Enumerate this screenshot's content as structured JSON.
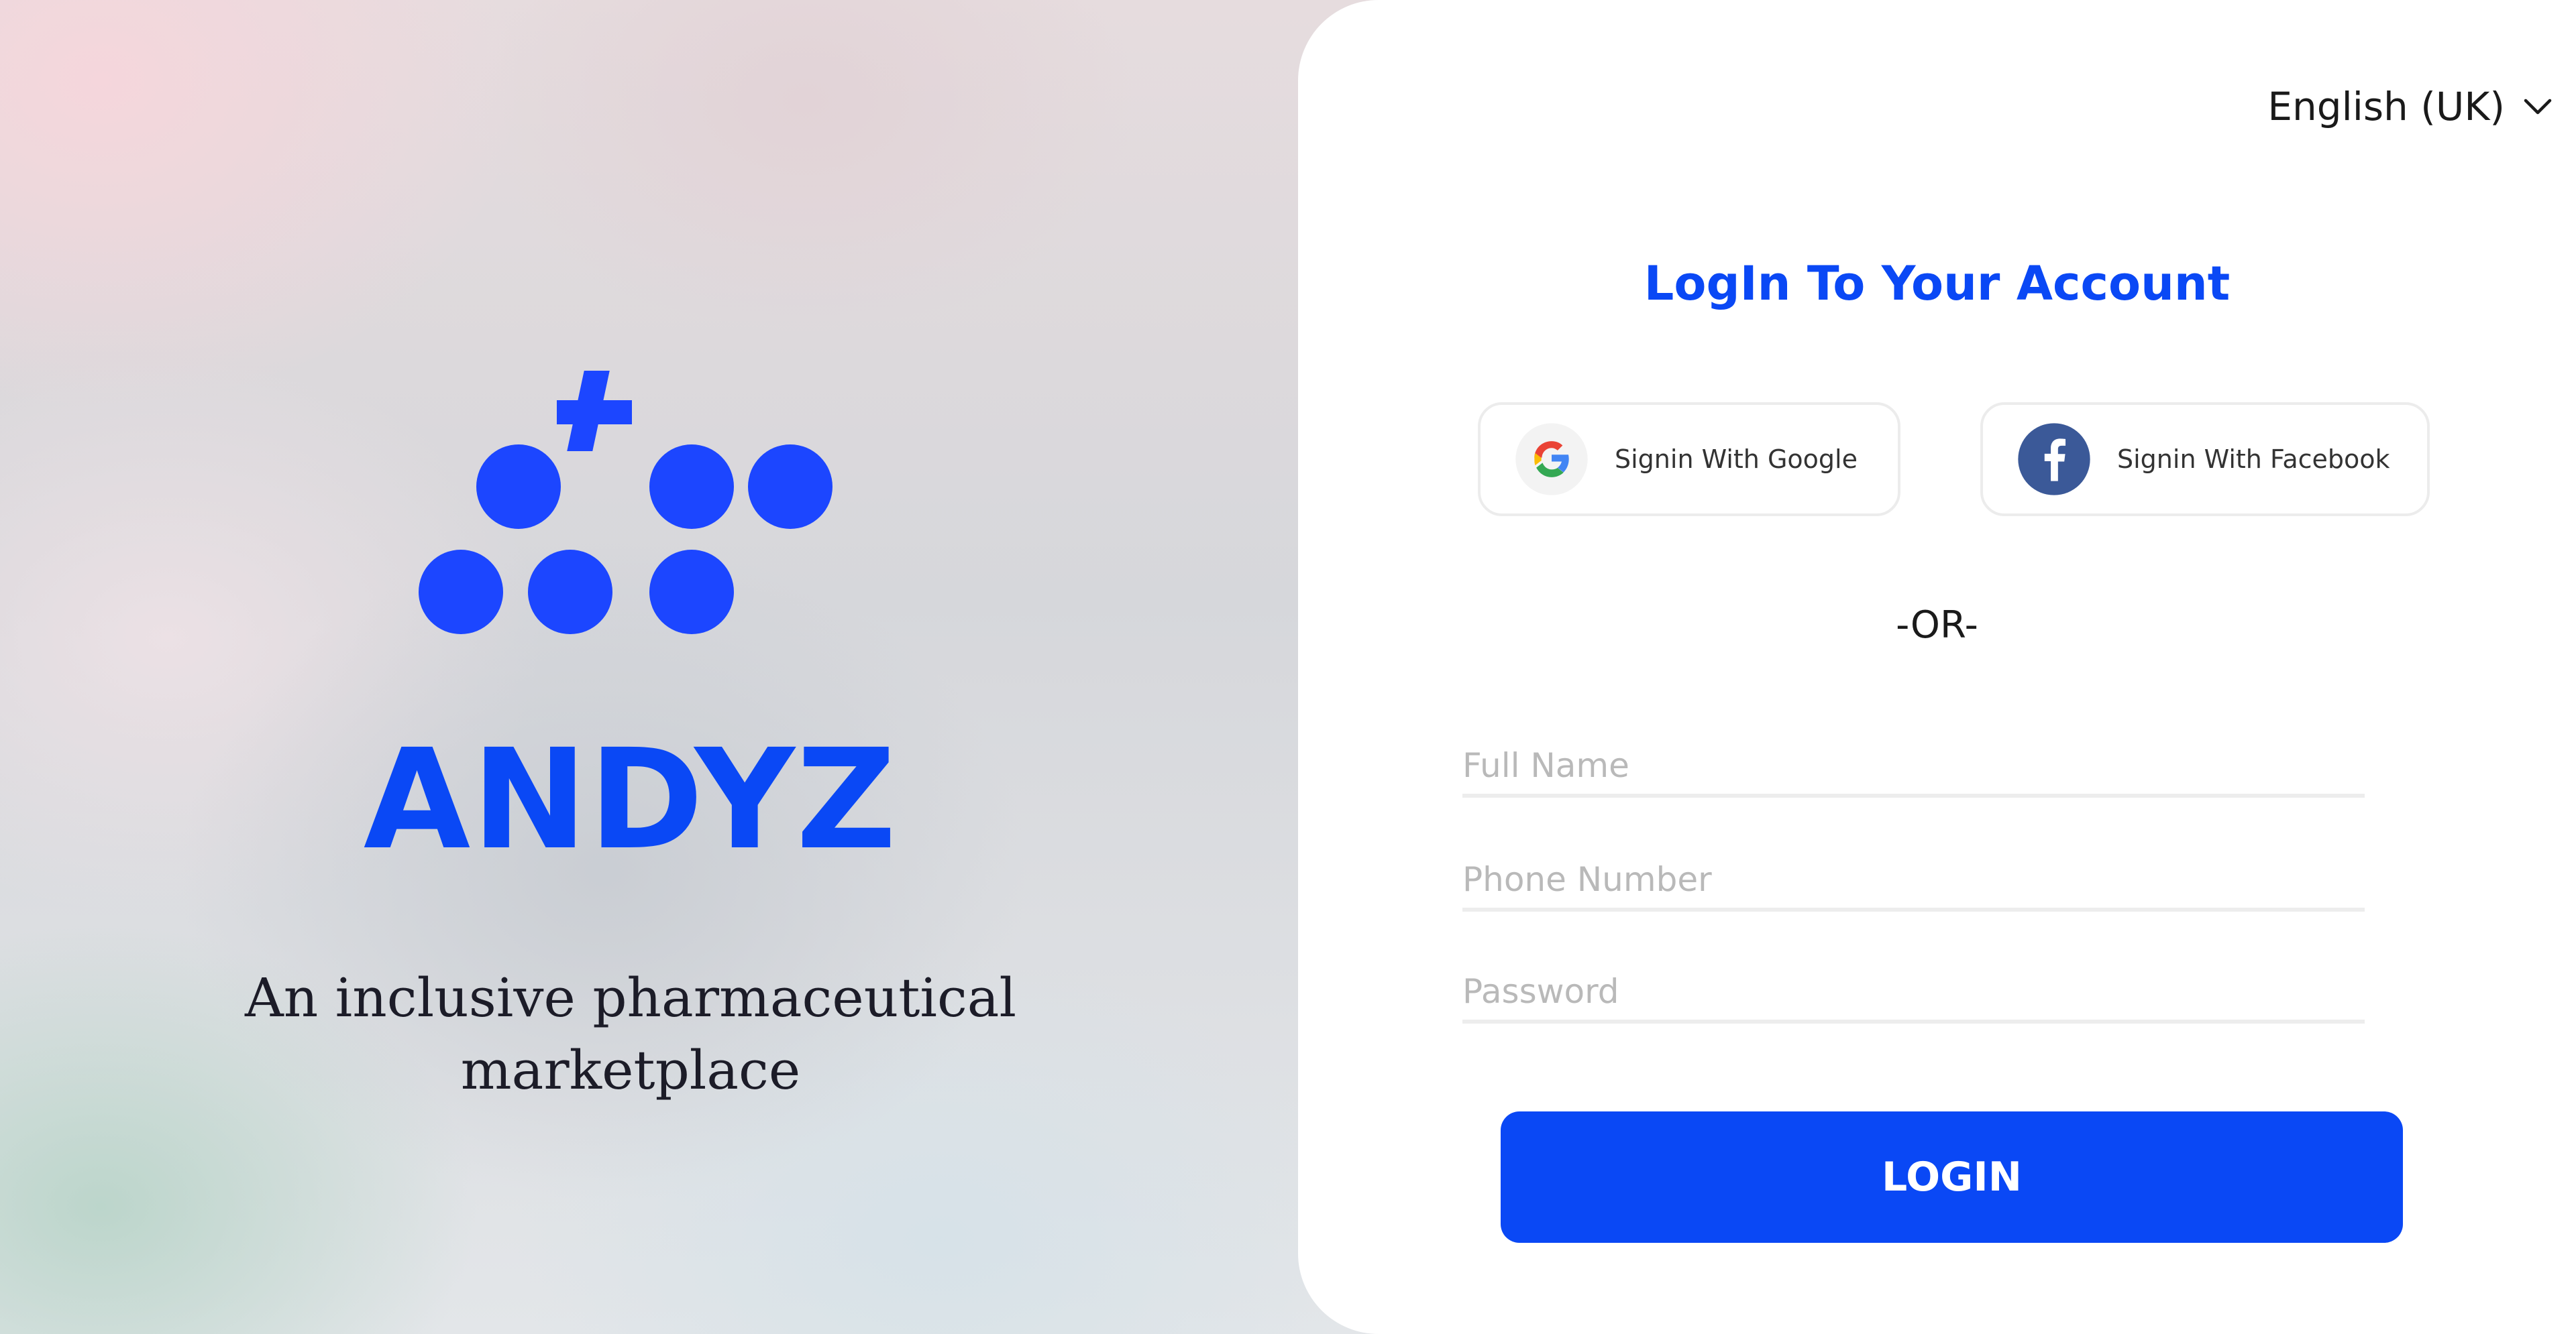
{
  "brand": {
    "name": "ANDYZ",
    "tagline_line1": "An inclusive pharmaceutical",
    "tagline_line2": "marketplace",
    "accent_color": "#1c46ff"
  },
  "language": {
    "selected": "English (UK)",
    "icon": "chevron-down-icon"
  },
  "login": {
    "title": "LogIn To Your Account",
    "google_label": "Signin With Google",
    "google_icon": "google-logo-icon",
    "facebook_label": "Signin With Facebook",
    "facebook_icon": "facebook-logo-icon",
    "or_text": "-OR-",
    "fields": {
      "full_name_placeholder": "Full Name",
      "phone_placeholder": "Phone Number",
      "password_placeholder": "Password"
    },
    "submit_label": "LOGIN",
    "primary_color": "#0a48f5"
  }
}
